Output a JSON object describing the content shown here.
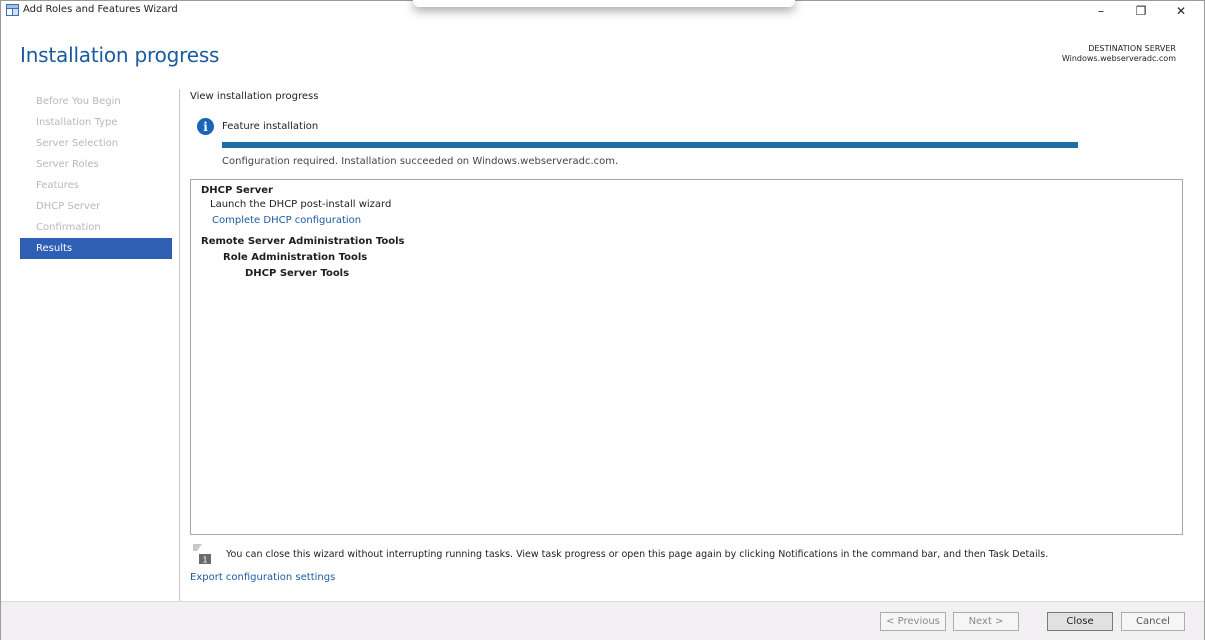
{
  "window": {
    "title": "Add Roles and Features Wizard",
    "controls": {
      "minimize": "–",
      "maximize": "❐",
      "close": "✕"
    }
  },
  "header": {
    "page_title": "Installation progress",
    "destination_label": "DESTINATION SERVER",
    "destination_name": "Windows.webserveradc.com"
  },
  "sidebar": {
    "items": [
      {
        "label": "Before You Begin",
        "active": false
      },
      {
        "label": "Installation Type",
        "active": false
      },
      {
        "label": "Server Selection",
        "active": false
      },
      {
        "label": "Server Roles",
        "active": false
      },
      {
        "label": "Features",
        "active": false
      },
      {
        "label": "DHCP Server",
        "active": false
      },
      {
        "label": "Confirmation",
        "active": false
      },
      {
        "label": "Results",
        "active": true
      }
    ]
  },
  "progress": {
    "heading": "View installation progress",
    "feature_label": "Feature installation",
    "percent": 100,
    "status": "Configuration required. Installation succeeded on Windows.webserveradc.com."
  },
  "results": {
    "dhcp_server": "DHCP Server",
    "launch_wizard": "Launch the DHCP post-install wizard",
    "complete_config_link": "Complete DHCP configuration",
    "rsat": "Remote Server Administration Tools",
    "role_admin_tools": "Role Administration Tools",
    "dhcp_server_tools": "DHCP Server Tools"
  },
  "note": {
    "text": "You can close this wizard without interrupting running tasks. View task progress or open this page again by clicking Notifications in the command bar, and then Task Details.",
    "export_link": "Export configuration settings"
  },
  "buttons": {
    "previous": "< Previous",
    "next": "Next >",
    "close": "Close",
    "cancel": "Cancel"
  },
  "colors": {
    "accent_blue": "#1a5b9f",
    "sidebar_active": "#2f5eb5",
    "progress_fill": "#1c6fa3"
  }
}
